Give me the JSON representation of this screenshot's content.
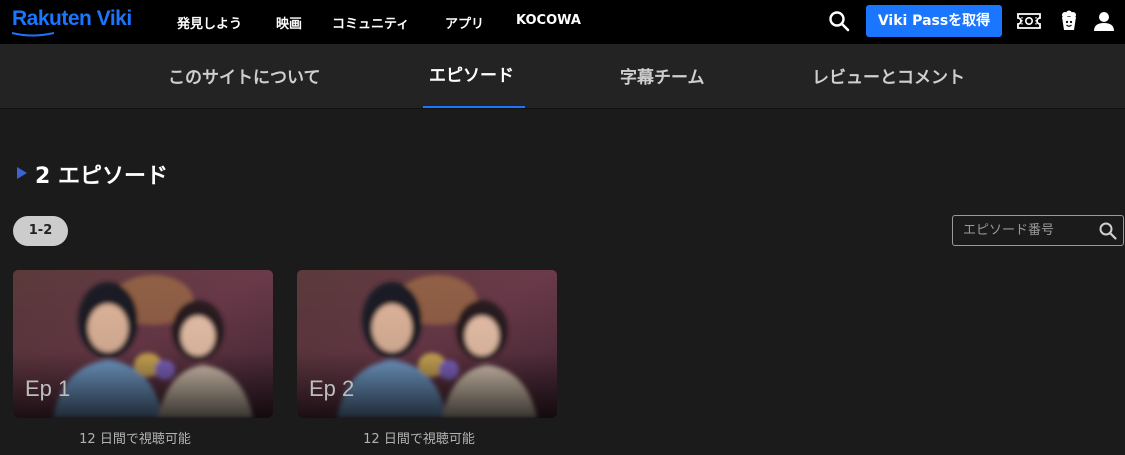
{
  "app": {
    "logo_text": "Rakuten Viki",
    "brand_color": "#1a75ff"
  },
  "topnav": {
    "links": [
      {
        "label": "発見しよう"
      },
      {
        "label": "映画"
      },
      {
        "label": "コミュニティ"
      },
      {
        "label": "アプリ"
      },
      {
        "label": "KOCOWA"
      }
    ],
    "viki_pass_label": "Viki Passを取得",
    "icons": [
      "search-icon",
      "ticket-icon",
      "popcorn-icon",
      "user-icon"
    ]
  },
  "tabs": [
    {
      "label": "このサイトについて",
      "active": false
    },
    {
      "label": "エピソード",
      "active": true
    },
    {
      "label": "字幕チーム",
      "active": false
    },
    {
      "label": "レビューとコメント",
      "active": false
    }
  ],
  "episodes_section": {
    "title": "2 エピソード",
    "range_chip": "1-2",
    "search_placeholder": "エピソード番号",
    "episodes": [
      {
        "label": "Ep 1",
        "status": "12 日間で視聴可能"
      },
      {
        "label": "Ep 2",
        "status": "12 日間で視聴可能"
      }
    ]
  }
}
